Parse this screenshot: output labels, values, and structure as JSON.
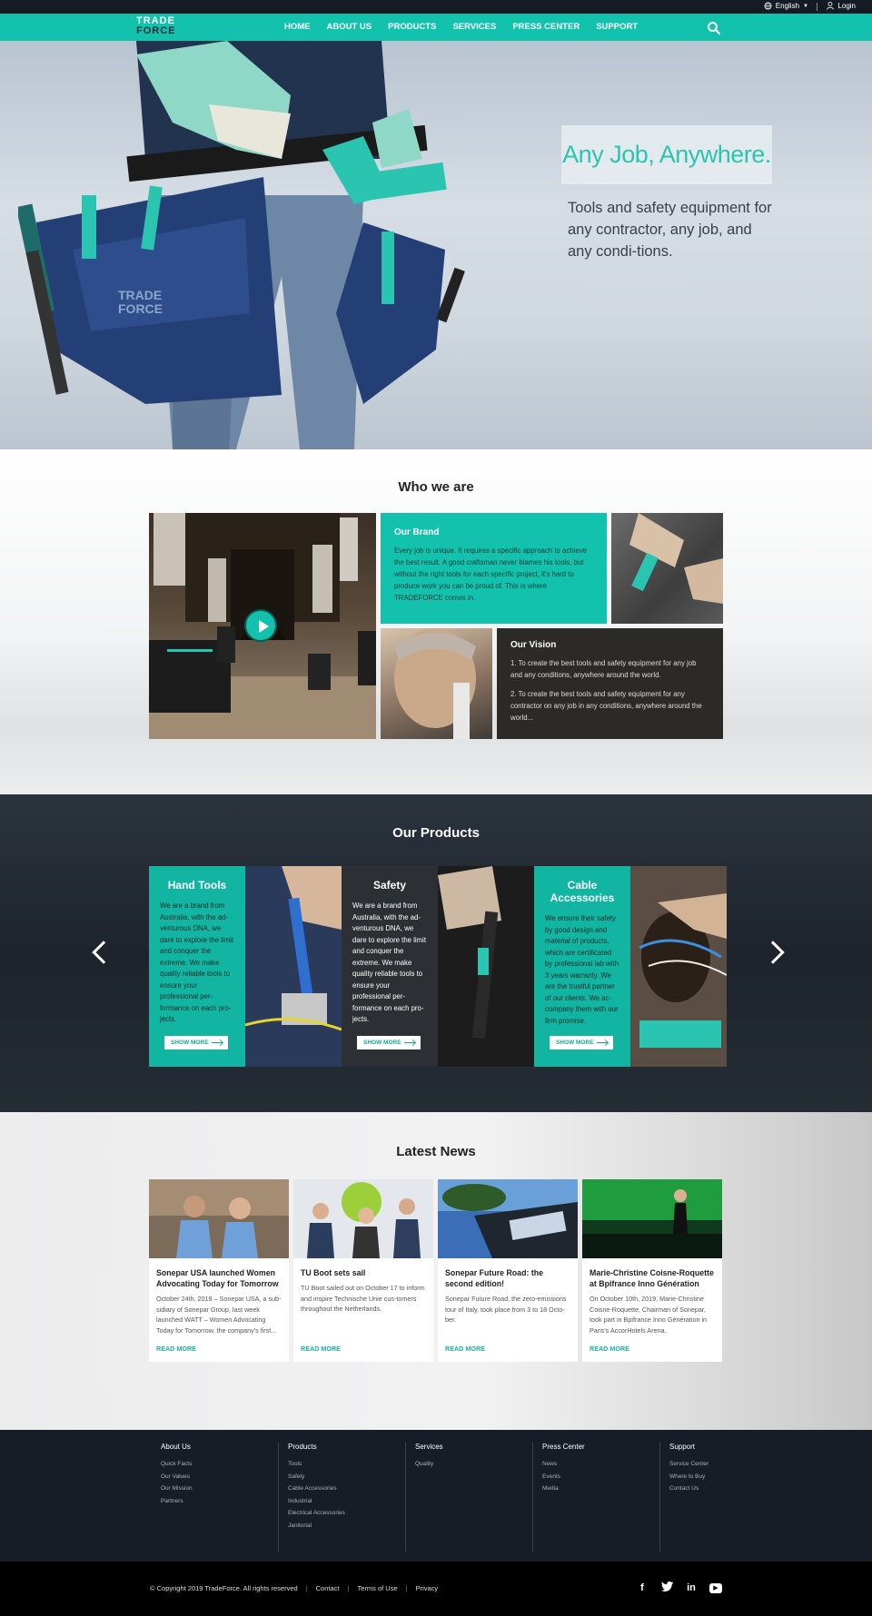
{
  "topbar": {
    "language": "English",
    "login": "Login"
  },
  "nav": {
    "logo_line1": "TRADE",
    "logo_line2": "FORCE",
    "items": [
      "HOME",
      "ABOUT US",
      "PRODUCTS",
      "SERVICES",
      "PRESS CENTER",
      "SUPPORT"
    ]
  },
  "hero": {
    "title": "Any Job, Anywhere.",
    "subtitle": "Tools and safety equipment for any contractor, any job, and any condi-tions."
  },
  "who": {
    "title": "Who we are",
    "brand_heading": "Our Brand",
    "brand_text": "Every job is unique. It requires a specific approach to achieve the best result. A good craftsman never blames his tools, but without the right tools for each specific project, it's hard to produce work you can be proud of. This is where TRADEFORCE comes in.",
    "vision_heading": "Our Vision",
    "vision_point1": "1. To create the best tools and safety equipment for any job and any conditions, anywhere around the world.",
    "vision_point2": "2. To create the best tools and safety equipment for any contractor on any job in any conditions, anywhere around the world..."
  },
  "products": {
    "title": "Our Products",
    "cards": [
      {
        "title": "Hand Tools",
        "text": "We are a brand from Australia, with the ad-venturous DNA, we dare to explore the limit and conquer the extreme. We make quality reliable tools to ensure your professional per-formance on each pro-jects.",
        "button": "SHOW MORE"
      },
      {
        "title": "Safety",
        "text": "We are a brand from Australia, with the ad-venturous DNA, we dare to explore the limit and conquer the extreme. We make quality reliable tools to ensure your professional per-formance on each pro-jects.",
        "button": "SHOW MORE"
      },
      {
        "title": "Cable Accessories",
        "text": "We ensure their safety by good design and material of products, which are certificated by professional lab with 3 years warranty. We are the trustful partner of our clients. We ac-company them with our firm promise.",
        "button": "SHOW MORE"
      }
    ]
  },
  "news": {
    "title": "Latest News",
    "read_more": "READ MORE",
    "items": [
      {
        "title": "Sonepar USA launched Women Advocating Today for Tomorrow",
        "text": "October 24th, 2019 – Sonepar USA, a sub-sidiary of Sonepar Group, last week launched WATT – Women Advocating Today for Tomorrow, the company's first..."
      },
      {
        "title": "TU Boot sets sail",
        "text": "TU Boot sailed out on October 17 to inform and inspire Technische Unie cus-tomers throughout the Netherlands."
      },
      {
        "title": "Sonepar Future Road: the second edition!",
        "text": "Sonepar Future Road, the zero-emissions tour of Italy, took place from 3 to 18 Octo-ber."
      },
      {
        "title": "Marie-Christine Coisne-Roquette at Bpifrance Inno Génération",
        "text": "On October 10th, 2019, Marie-Christine Coisne-Roquette, Chairman of Sonepar, took part in Bpifrance Inno Génération in Paris's AccorHotels Arena."
      }
    ]
  },
  "footer": {
    "columns": [
      {
        "heading": "About Us",
        "links": [
          "Quick Facts",
          "Our Values",
          "Our Mission",
          "Partners"
        ]
      },
      {
        "heading": "Products",
        "links": [
          "Tools",
          "Safety",
          "Cable Accessories",
          "Industrial",
          "Electrical Accessories",
          "Janitorial"
        ]
      },
      {
        "heading": "Services",
        "links": [
          "Quality"
        ]
      },
      {
        "heading": "Press Center",
        "links": [
          "News",
          "Events",
          "Media"
        ]
      },
      {
        "heading": "Support",
        "links": [
          "Service Center",
          "Where to Buy",
          "Contact Us"
        ]
      }
    ],
    "copyright": "© Copyright  2019 TradeForce. All rights reserved",
    "contact": "Contact",
    "terms": "Terms of Use",
    "privacy": "Privacy",
    "social": [
      "facebook-icon",
      "twitter-icon",
      "linkedin-icon",
      "youtube-icon"
    ]
  },
  "colors": {
    "accent": "#12c2ad",
    "dark": "#161d26"
  }
}
